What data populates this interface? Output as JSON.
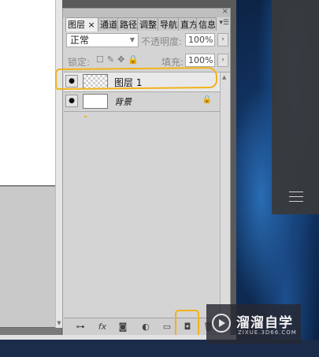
{
  "layers_panel": {
    "tabs": [
      {
        "label": "图层 ×",
        "active": true
      },
      {
        "label": "通道"
      },
      {
        "label": "路径"
      },
      {
        "label": "调整"
      },
      {
        "label": "导航器"
      },
      {
        "label": "直方图"
      },
      {
        "label": "信息"
      }
    ],
    "blend_mode": "正常",
    "opacity_label": "不透明度:",
    "opacity_value": "100%",
    "lock_label": "锁定:",
    "fill_label": "填充:",
    "fill_value": "100%",
    "layers": [
      {
        "name": "图层 1",
        "visible": true,
        "thumbnail": "transparent",
        "selected": true
      },
      {
        "name": "背景",
        "visible": true,
        "thumbnail": "white",
        "locked": true
      }
    ],
    "bottom_icons": [
      "link-layers-icon",
      "fx-icon",
      "add-mask-icon",
      "adjustment-layer-icon",
      "new-group-icon",
      "new-layer-icon",
      "trash-icon"
    ]
  },
  "annotations": {
    "color": "#f2b21a"
  },
  "watermark": {
    "title": "溜溜自学",
    "subtitle": "ZIXUE.3D66.COM"
  }
}
